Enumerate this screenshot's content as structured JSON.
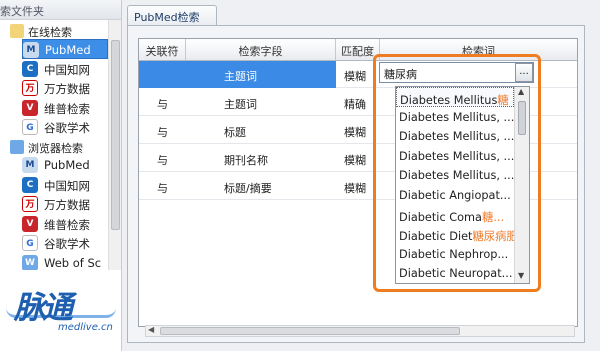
{
  "sidebar": {
    "top_label": "索文件夹",
    "groups": [
      {
        "label": "在线检索"
      },
      {
        "label": "浏览器检索"
      }
    ],
    "online_items": [
      {
        "label": "PubMed",
        "icon": "pubmed-icon",
        "glyph": "M"
      },
      {
        "label": "中国知网",
        "icon": "cnki-icon",
        "glyph": "C"
      },
      {
        "label": "万方数据",
        "icon": "wanfang-icon",
        "glyph": "万"
      },
      {
        "label": "维普检索",
        "icon": "weipu-icon",
        "glyph": "V"
      },
      {
        "label": "谷歌学术",
        "icon": "google-icon",
        "glyph": "G"
      }
    ],
    "browser_items": [
      {
        "label": "PubMed",
        "icon": "pubmed-icon",
        "glyph": "M"
      },
      {
        "label": "中国知网",
        "icon": "cnki-icon",
        "glyph": "C"
      },
      {
        "label": "万方数据",
        "icon": "wanfang-icon",
        "glyph": "万"
      },
      {
        "label": "维普检索",
        "icon": "weipu-icon",
        "glyph": "V"
      },
      {
        "label": "谷歌学术",
        "icon": "google-icon",
        "glyph": "G"
      },
      {
        "label": "Web of Sc",
        "icon": "web-of-science-icon",
        "glyph": "W"
      }
    ],
    "selected_item": "PubMed",
    "logo_text": "脉通",
    "logo_sub": "medlive.cn"
  },
  "tab": {
    "label": "PubMed检索"
  },
  "grid": {
    "headers": [
      "关联符",
      "检索字段",
      "匹配度",
      "检索词"
    ],
    "rows": [
      {
        "connector": "",
        "field": "主题词",
        "match": "模糊"
      },
      {
        "connector": "与",
        "field": "主题词",
        "match": "精确"
      },
      {
        "connector": "与",
        "field": "标题",
        "match": "模糊"
      },
      {
        "connector": "与",
        "field": "期刊名称",
        "match": "模糊"
      },
      {
        "connector": "与",
        "field": "标题/摘要",
        "match": "模糊"
      }
    ]
  },
  "keyword": {
    "value": "糖尿病",
    "button_label": "..."
  },
  "dropdown": {
    "items": [
      {
        "text": "Diabetes Mellitus",
        "hl": "糖"
      },
      {
        "text": "Diabetes Mellitus, ...",
        "hl": ""
      },
      {
        "text": "Diabetes Mellitus, ...",
        "hl": ""
      },
      {
        "text": "Diabetes Mellitus, ...",
        "hl": ""
      },
      {
        "text": "Diabetes Mellitus, ...",
        "hl": ""
      },
      {
        "text": "Diabetic Angiopat...",
        "hl": ""
      },
      {
        "text": "Diabetic Coma",
        "hl": "糖..."
      },
      {
        "text": "Diabetic Diet",
        "hl": "糖尿病肥"
      },
      {
        "text": "Diabetic Nephrop...",
        "hl": ""
      },
      {
        "text": "Diabetic Neuropat...",
        "hl": ""
      }
    ]
  },
  "colors": {
    "highlight_frame": "#ee7d22",
    "selection": "#3b8ae6",
    "match_highlight": "#f07a2a"
  }
}
